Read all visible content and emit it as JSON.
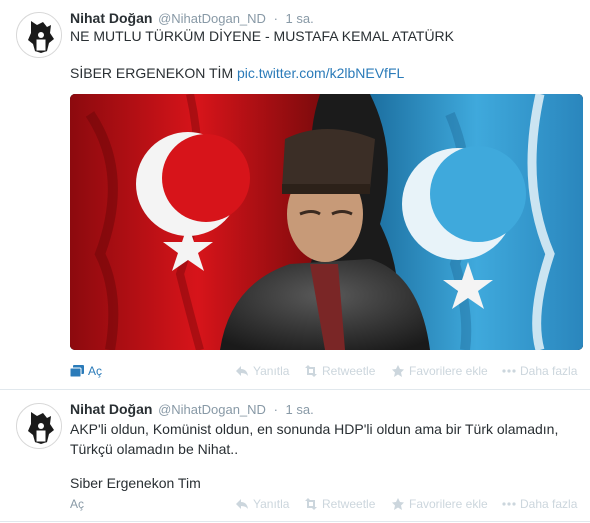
{
  "tweets": [
    {
      "fullname": "Nihat Doğan",
      "username": "@NihatDogan_ND",
      "separator": "·",
      "time": "1 sa.",
      "line1": "NE MUTLU TÜRKÜM DİYENE - MUSTAFA KEMAL ATATÜRK",
      "line2_text": "SİBER ERGENEKON TİM",
      "line2_link": "pic.twitter.com/k2lbNEVfFL",
      "expand_label": "Aç",
      "actions": {
        "reply": "Yanıtla",
        "retweet": "Retweetle",
        "favorite": "Favorilere ekle",
        "more": "Daha fazla"
      }
    },
    {
      "fullname": "Nihat Doğan",
      "username": "@NihatDogan_ND",
      "separator": "·",
      "time": "1 sa.",
      "line1": "AKP'li oldun, Komünist oldun, en sonunda HDP'li oldun ama bir Türk olamadın,",
      "line2": "Türkçü olamadın be Nihat..",
      "line3": "Siber Ergenekon Tim",
      "expand_label": "Aç",
      "actions": {
        "reply": "Yanıtla",
        "retweet": "Retweetle",
        "favorite": "Favorilere ekle",
        "more": "Daha fazla"
      }
    }
  ],
  "colors": {
    "link": "#2b7bb9",
    "meta": "#8899a6",
    "action": "#ccd6dd",
    "turkish_flag": "#d7141a",
    "turkic_flag": "#3fa9dc"
  }
}
